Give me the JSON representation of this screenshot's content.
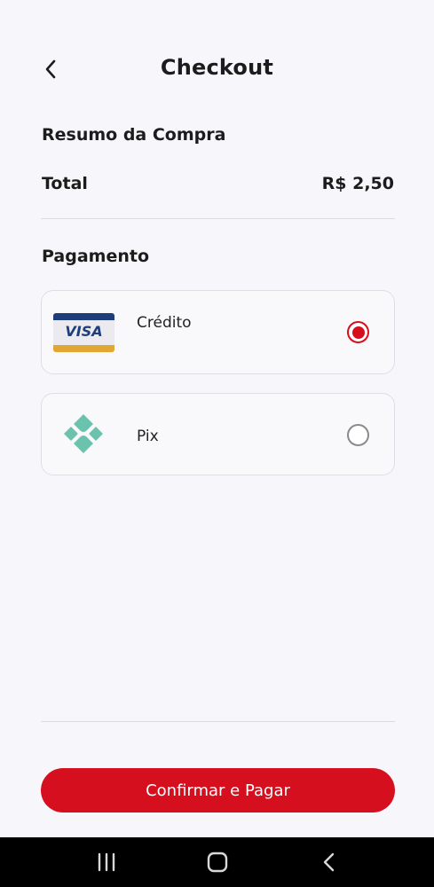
{
  "header": {
    "title": "Checkout",
    "back_icon": "chevron-left-icon"
  },
  "summary": {
    "title": "Resumo da Compra",
    "total_label": "Total",
    "total_value": "R$ 2,50"
  },
  "payment": {
    "title": "Pagamento",
    "options": [
      {
        "label": "Crédito",
        "icon": "visa-card-icon",
        "logo_text": "VISA",
        "selected": true
      },
      {
        "label": "Pix",
        "icon": "pix-icon",
        "selected": false
      }
    ]
  },
  "footer": {
    "confirm_label": "Confirmar e Pagar"
  },
  "colors": {
    "accent": "#d50f1e",
    "background": "#f7f7fb",
    "pix": "#6cc3ad",
    "visa_blue": "#1f3d7a",
    "visa_gold": "#e2a632"
  },
  "system_nav": {
    "recents_icon": "recents-icon",
    "home_icon": "home-icon",
    "back_icon": "back-icon"
  }
}
